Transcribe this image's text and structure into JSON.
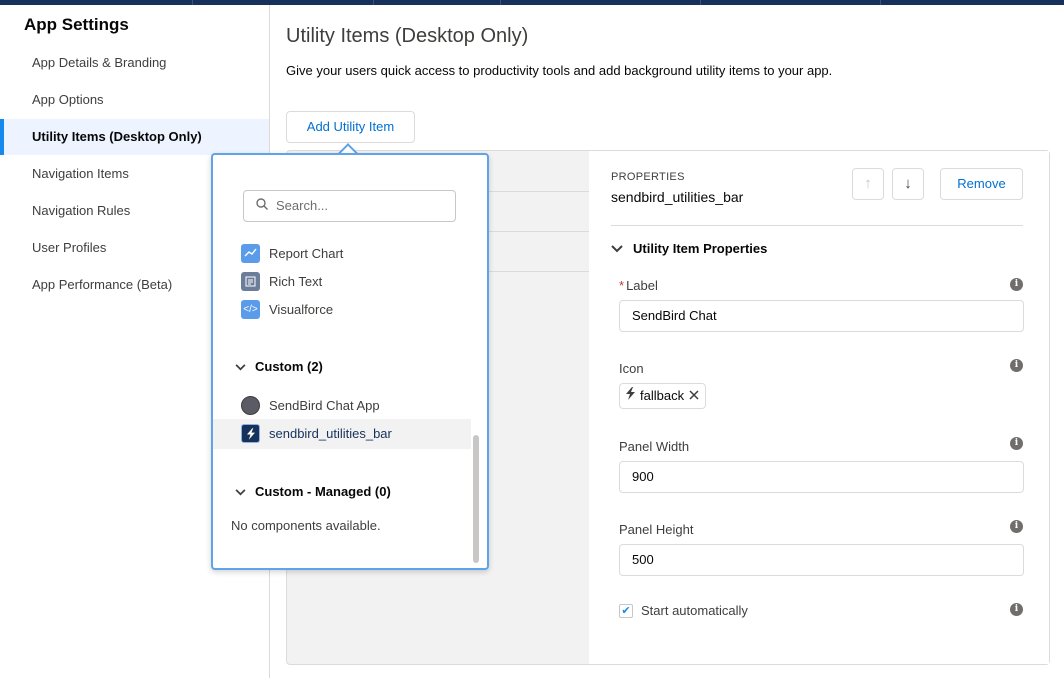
{
  "sidebar": {
    "title": "App Settings",
    "items": [
      {
        "label": "App Details & Branding"
      },
      {
        "label": "App Options"
      },
      {
        "label": "Utility Items (Desktop Only)"
      },
      {
        "label": "Navigation Items"
      },
      {
        "label": "Navigation Rules"
      },
      {
        "label": "User Profiles"
      },
      {
        "label": "App Performance (Beta)"
      }
    ],
    "active_index": 2
  },
  "main": {
    "title": "Utility Items (Desktop Only)",
    "description": "Give your users quick access to productivity tools and add background utility items to your app.",
    "add_button": "Add Utility Item"
  },
  "properties": {
    "heading": "PROPERTIES",
    "item_name": "sendbird_utilities_bar",
    "remove_button": "Remove",
    "section_title": "Utility Item Properties",
    "label_field": {
      "label": "Label",
      "required_mark": "*",
      "value": "SendBird Chat"
    },
    "icon_field": {
      "label": "Icon",
      "value": "fallback"
    },
    "panel_width_field": {
      "label": "Panel Width",
      "value": "900"
    },
    "panel_height_field": {
      "label": "Panel Height",
      "value": "500"
    },
    "start_auto": {
      "label": "Start automatically",
      "checked": true
    }
  },
  "picker": {
    "search_placeholder": "Search...",
    "standard_items": [
      {
        "label": "Report Chart",
        "icon": "report-chart-icon",
        "color": "#5a9bea"
      },
      {
        "label": "Rich Text",
        "icon": "rich-text-icon",
        "color": "#6b7d99"
      },
      {
        "label": "Visualforce",
        "icon": "visualforce-icon",
        "color": "#5a9bea"
      }
    ],
    "custom_group": "Custom (2)",
    "custom_items": [
      {
        "label": "SendBird Chat App",
        "icon": "circle-icon"
      },
      {
        "label": "sendbird_utilities_bar",
        "icon": "lightning-icon"
      }
    ],
    "managed_group": "Custom - Managed (0)",
    "empty_text": "No components available."
  }
}
